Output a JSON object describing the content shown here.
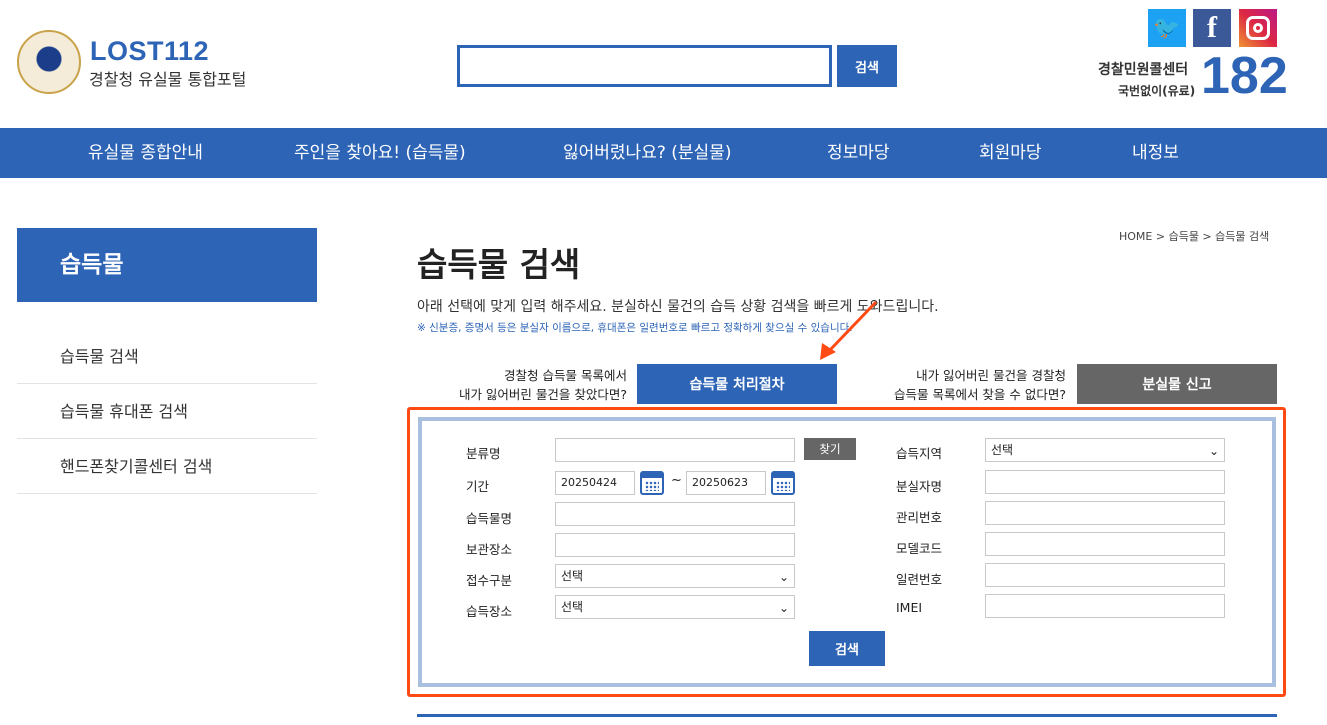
{
  "header": {
    "logo_title": "LOST112",
    "logo_subtitle": "경찰청 유실물 통합포털",
    "search_button": "검색",
    "sns": [
      "twitter-icon",
      "facebook-icon",
      "instagram-icon"
    ],
    "facebook_glyph": "f",
    "twitter_glyph": "🐦",
    "call_center_label": "경찰민원콜센터",
    "call_center_sub": "국번없이(유료)",
    "call_center_number": "182"
  },
  "nav": {
    "items": [
      "유실물 종합안내",
      "주인을 찾아요! (습득물)",
      "잃어버렸나요? (분실물)",
      "정보마당",
      "회원마당",
      "내정보"
    ]
  },
  "sidebar": {
    "title": "습득물",
    "items": [
      "습득물 검색",
      "습득물 휴대폰 검색",
      "핸드폰찾기콜센터 검색"
    ]
  },
  "main": {
    "breadcrumb": "HOME > 습득물 > 습득물 검색",
    "title": "습득물 검색",
    "description": "아래 선택에 맞게 입력 해주세요. 분실하신 물건의 습득 상황 검색을 빠르게 도와드립니다.",
    "note": "※ 신분증, 증명서 등은 분실자 이름으로, 휴대폰은 일련번호로 빠르고 정확하게 찾으실 수 있습니다.",
    "left_question_line1": "경찰청 습득물 목록에서",
    "left_question_line2": "내가 잃어버린 물건을 찾았다면?",
    "left_button": "습득물 처리절차",
    "right_question_line1": "내가 잃어버린 물건을 경찰청",
    "right_question_line2": "습득물 목록에서 찾을 수 없다면?",
    "right_button": "분실물 신고"
  },
  "form": {
    "category_label": "분류명",
    "category_value": "",
    "find_button": "찾기",
    "period_label": "기간",
    "date_from": "20250424",
    "date_to": "20250623",
    "tilde": "~",
    "item_name_label": "습득물명",
    "item_name_value": "",
    "storage_label": "보관장소",
    "storage_value": "",
    "receipt_type_label": "접수구분",
    "receipt_type_value": "선택",
    "found_place_label": "습득장소",
    "found_place_value": "선택",
    "region_label": "습득지역",
    "region_value": "선택",
    "owner_name_label": "분실자명",
    "owner_name_value": "",
    "manage_no_label": "관리번호",
    "manage_no_value": "",
    "model_code_label": "모델코드",
    "model_code_value": "",
    "serial_no_label": "일련번호",
    "serial_no_value": "",
    "imei_label": "IMEI",
    "imei_value": "",
    "submit_button": "검색",
    "select_chevron": "⌄"
  },
  "colors": {
    "brand_blue": "#2d64b6",
    "highlight_red": "#ff4a14",
    "gray_button": "#666666"
  }
}
